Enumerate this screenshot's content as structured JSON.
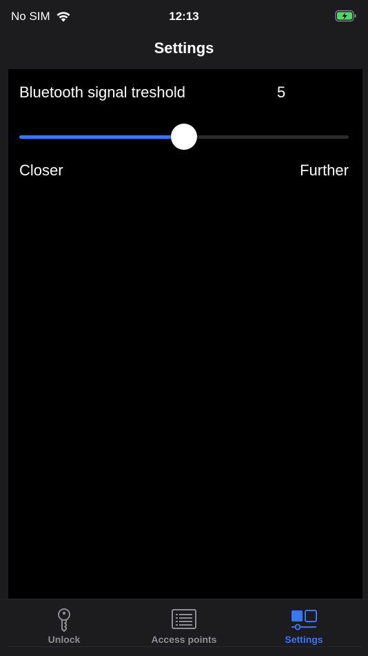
{
  "status_bar": {
    "carrier": "No SIM",
    "time": "12:13",
    "battery_color": "#4cd964"
  },
  "nav": {
    "title": "Settings"
  },
  "setting": {
    "label": "Bluetooth signal treshold",
    "value": "5",
    "slider_fraction": 0.5,
    "min_label": "Closer",
    "max_label": "Further"
  },
  "tabs": [
    {
      "label": "Unlock",
      "icon": "key-icon",
      "active": false
    },
    {
      "label": "Access points",
      "icon": "list-icon",
      "active": false
    },
    {
      "label": "Settings",
      "icon": "settings-panels-icon",
      "active": true
    }
  ],
  "colors": {
    "accent": "#3478f6",
    "inactive": "#8e8e93",
    "background": "#1c1c1e",
    "content_background": "#000000"
  }
}
